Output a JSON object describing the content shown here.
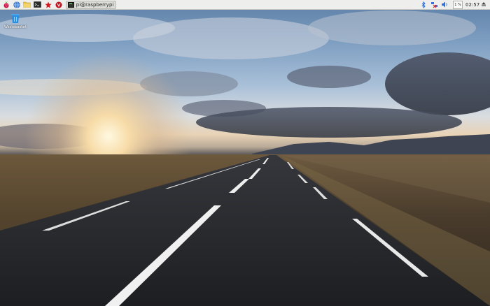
{
  "taskbar": {
    "launchers": [
      {
        "name": "menu",
        "icon": "raspberry-icon"
      },
      {
        "name": "web-browser",
        "icon": "globe-icon"
      },
      {
        "name": "file-manager",
        "icon": "folder-icon"
      },
      {
        "name": "terminal",
        "icon": "terminal-icon"
      },
      {
        "name": "mathematica",
        "icon": "mathematica-icon"
      },
      {
        "name": "wolfram",
        "icon": "wolfram-icon"
      }
    ],
    "window_button_label": "pi@raspberrypi: ~",
    "tray": {
      "bluetooth_icon": "bluetooth-icon",
      "network_icon": "network-disconnected-icon",
      "volume_icon": "volume-icon",
      "cpu_usage": "1 %",
      "clock": "02:57",
      "eject_icon": "eject-icon"
    }
  },
  "desktop": {
    "icons": [
      {
        "label": "Wastebasket",
        "icon": "trash-icon"
      }
    ]
  },
  "colors": {
    "taskbar_bg": "#eeeeec",
    "raspberry_red": "#c51a4a",
    "bluetooth_blue": "#2a6fdb"
  }
}
